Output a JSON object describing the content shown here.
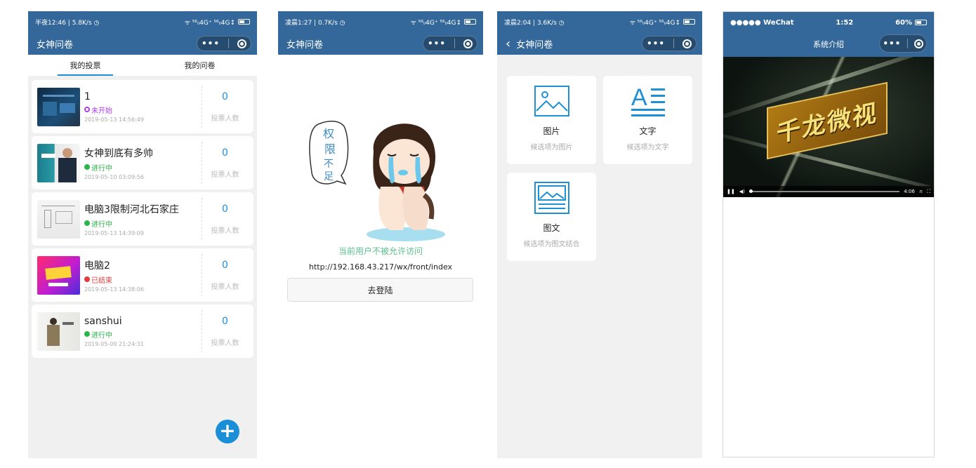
{
  "screen1": {
    "status_left": "半夜12:46 | 5.8K/s ◷",
    "status_right": "ᯤ ⁵⁶ᵢₗ4G⁺ ⁵⁶ᵢₗ4G↕",
    "title": "女神问卷",
    "tabs": [
      "我的投票",
      "我的问卷"
    ],
    "count_label": "投票人数",
    "items": [
      {
        "title": "1",
        "state": "未开始",
        "state_color": "#b040e0",
        "date": "2019-05-13 14:56:49",
        "count": "0"
      },
      {
        "title": "女神到底有多帅",
        "state": "进行中",
        "state_color": "#2bb54a",
        "date": "2019-05-10 03:09:56",
        "count": "0"
      },
      {
        "title": "电脑3限制河北石家庄",
        "state": "进行中",
        "state_color": "#2bb54a",
        "date": "2019-05-13 14:39:09",
        "count": "0"
      },
      {
        "title": "电脑2",
        "state": "已结束",
        "state_color": "#e23a3a",
        "date": "2019-05-13 14:38:06",
        "count": "0"
      },
      {
        "title": "sanshui",
        "state": "进行中",
        "state_color": "#2bb54a",
        "date": "2019-05-09 21:24:31",
        "count": "0"
      }
    ],
    "fab": "+"
  },
  "screen2": {
    "status_left": "凌晨1:27 | 0.7K/s ◷",
    "status_right": "ᯤ ⁵⁶ᵢₗ4G⁺ ⁵⁶ᵢₗ4G↕",
    "title": "女神问卷",
    "bubble_text": "权限不足",
    "deny_text": "当前用户不被允许访问",
    "url": "http://192.168.43.217/wx/front/index",
    "login_button": "去登陆"
  },
  "screen3": {
    "status_left": "凌晨2:04 | 3.6K/s ◷",
    "status_right": "ᯤ ⁵⁶ᵢₗ4G⁺ ⁵⁶ᵢₗ4G↕",
    "back": "‹",
    "title": "女神问卷",
    "options": [
      {
        "name": "图片",
        "desc": "候选项为图片"
      },
      {
        "name": "文字",
        "desc": "候选项为文字"
      },
      {
        "name": "图文",
        "desc": "候选项为图文结合"
      }
    ]
  },
  "screen4": {
    "status_left": "●●●●● WeChat",
    "status_time": "1:52",
    "status_right": "60%",
    "title": "系统介绍",
    "video_text": "千龙微视",
    "video_time": "4:06"
  },
  "colors": {
    "navbar": "#34689a",
    "accent": "#1a8fd8",
    "deny_green": "#5bbf8e"
  }
}
